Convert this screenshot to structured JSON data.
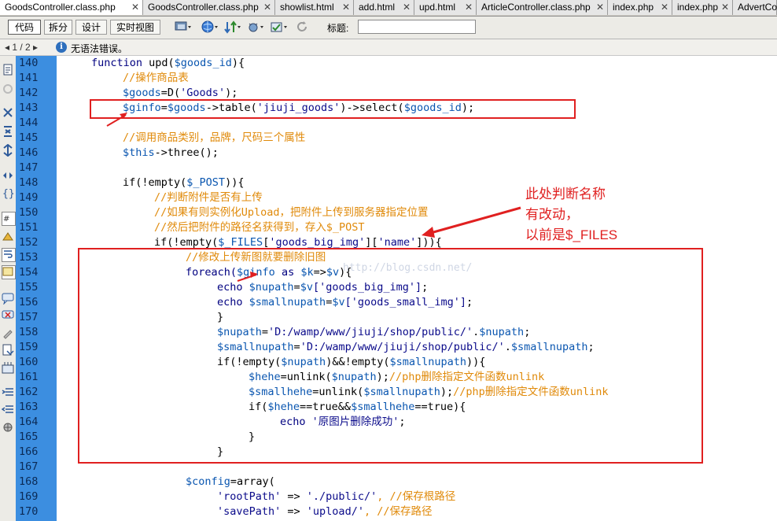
{
  "tabs": [
    {
      "label": "GoodsController.class.php",
      "active": true,
      "closable": true
    },
    {
      "label": "GoodsController.class.php",
      "active": false,
      "closable": true
    },
    {
      "label": "showlist.html",
      "active": false,
      "closable": true
    },
    {
      "label": "add.html",
      "active": false,
      "closable": true
    },
    {
      "label": "upd.html",
      "active": false,
      "closable": true
    },
    {
      "label": "ArticleController.class.php",
      "active": false,
      "closable": true
    },
    {
      "label": "index.php",
      "active": false,
      "closable": true
    },
    {
      "label": "index.php",
      "active": false,
      "closable": true
    },
    {
      "label": "AdvertCo",
      "active": false,
      "closable": false
    }
  ],
  "toolbar": {
    "views": [
      "代码",
      "拆分",
      "设计",
      "实时视图"
    ],
    "active_view": "代码",
    "title_label": "标题:",
    "title_value": ""
  },
  "status": {
    "page_nav": "1 / 2",
    "message": "无语法错误。"
  },
  "line_numbers": [
    "140",
    "141",
    "142",
    "143",
    "144",
    "145",
    "146",
    "147",
    "148",
    "149",
    "150",
    "151",
    "152",
    "153",
    "154",
    "155",
    "156",
    "157",
    "158",
    "159",
    "160",
    "161",
    "162",
    "163",
    "164",
    "165",
    "166",
    "167",
    "168",
    "169",
    "170"
  ],
  "code": {
    "l140_kw": "function",
    "l140_rest": " upd(",
    "l140_var": "$goods_id",
    "l140_end": "){",
    "l141": "//操作商品表",
    "l142_var": "$goods",
    "l142_rest": "=D(",
    "l142_str": "'Goods'",
    "l142_end": ");",
    "l143_v1": "$ginfo",
    "l143_eq": "=",
    "l143_v2": "$goods",
    "l143_mid": "->table(",
    "l143_str": "'jiuji_goods'",
    "l143_sel": ")->select(",
    "l143_v3": "$goods_id",
    "l143_end": ");",
    "l145": "//调用商品类别，品牌，尺码三个属性",
    "l146_var": "$this",
    "l146_rest": "->three();",
    "l148_pre": "if(!empty(",
    "l148_var": "$_POST",
    "l148_end": ")){",
    "l149": "//判断附件是否有上传",
    "l150": "//如果有则实例化Upload，把附件上传到服务器指定位置",
    "l151": "//然后把附件的路径名获得到，存入$_POST",
    "l152_pre": "if(!empty(",
    "l152_var": "$_FILES",
    "l152_mid": "[",
    "l152_s1": "'goods_big_img'",
    "l152_mid2": "][",
    "l152_s2": "'name'",
    "l152_end": "])){",
    "l153": "//修改上传新图就要删除旧图",
    "l154_kw": "foreach(",
    "l154_v1": "$ginfo",
    "l154_as": " as ",
    "l154_v2": "$k",
    "l154_arrow": "=>",
    "l154_v3": "$v",
    "l154_end": "){",
    "l155_kw": "echo ",
    "l155_v1": "$nupath",
    "l155_eq": "=",
    "l155_v2": "$v",
    "l155_s": "['goods_big_img']",
    "l155_end": ";",
    "l156_kw": "echo ",
    "l156_v1": "$smallnupath",
    "l156_eq": "=",
    "l156_v2": "$v",
    "l156_s": "['goods_small_img']",
    "l156_end": ";",
    "l157": "}",
    "l158_v": "$nupath",
    "l158_eq": "=",
    "l158_s": "'D:/wamp/www/jiuji/shop/public/'",
    "l158_dot": ".",
    "l158_v2": "$nupath",
    "l158_end": ";",
    "l159_v": "$smallnupath",
    "l159_eq": "=",
    "l159_s": "'D:/wamp/www/jiuji/shop/public/'",
    "l159_dot": ".",
    "l159_v2": "$smallnupath",
    "l159_end": ";",
    "l160_pre": "if(!empty(",
    "l160_v1": "$nupath",
    "l160_mid": ")&&!empty(",
    "l160_v2": "$smallnupath",
    "l160_end": ")){",
    "l161_v": "$hehe",
    "l161_mid": "=unlink(",
    "l161_v2": "$nupath",
    "l161_end": ");",
    "l161_c": "//php删除指定文件函数unlink",
    "l162_v": "$smallhehe",
    "l162_mid": "=unlink(",
    "l162_v2": "$smallnupath",
    "l162_end": ");",
    "l162_c": "//php删除指定文件函数unlink",
    "l163_pre": "if(",
    "l163_v1": "$hehe",
    "l163_mid": "==true&&",
    "l163_v2": "$smallhehe",
    "l163_end": "==true){",
    "l164_kw": "echo ",
    "l164_s": "'原图片删除成功'",
    "l164_end": ";",
    "l165": "}",
    "l166": "}",
    "l168_v": "$config",
    "l168_rest": "=array(",
    "l169_s1": "'rootPath'",
    "l169_op": " => ",
    "l169_s2": "'./public/'",
    "l169_c": ", //保存根路径",
    "l170_s1": "'savePath'",
    "l170_op": " => ",
    "l170_s2": "'upload/'",
    "l170_c": ", //保存路径"
  },
  "annotation": {
    "line1": "此处判断名称",
    "line2": "有改动，",
    "line3": "以前是$_FILES"
  },
  "watermark": "http://blog.csdn.net/",
  "colors": {
    "gutter": "#3c8ee0",
    "keyword": "#000080",
    "variable": "#0a56b0",
    "comment": "#e08a0a",
    "annotation_red": "#e02020"
  }
}
